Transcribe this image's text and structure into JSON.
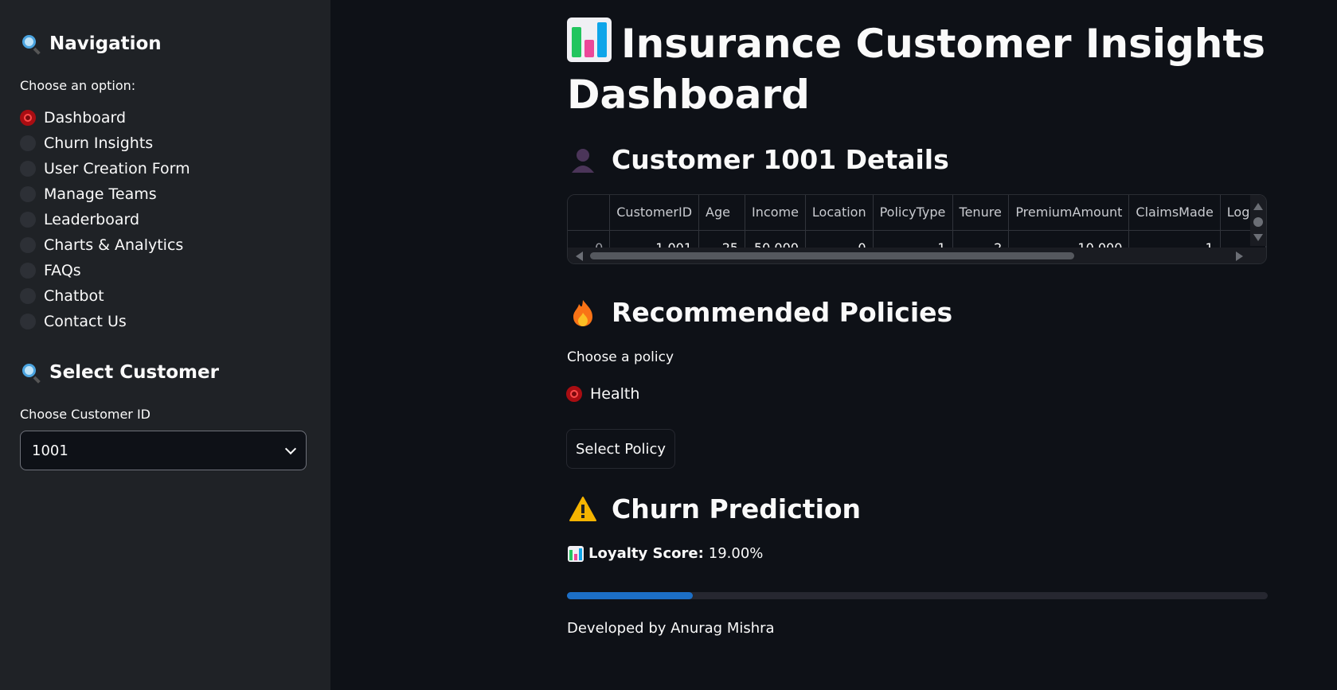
{
  "sidebar": {
    "nav_heading": "Navigation",
    "nav_prompt": "Choose an option:",
    "nav_items": [
      {
        "label": "Dashboard",
        "selected": true
      },
      {
        "label": "Churn Insights",
        "selected": false
      },
      {
        "label": "User Creation Form",
        "selected": false
      },
      {
        "label": "Manage Teams",
        "selected": false
      },
      {
        "label": "Leaderboard",
        "selected": false
      },
      {
        "label": "Charts & Analytics",
        "selected": false
      },
      {
        "label": "FAQs",
        "selected": false
      },
      {
        "label": "Chatbot",
        "selected": false
      },
      {
        "label": "Contact Us",
        "selected": false
      }
    ],
    "customer_heading": "Select Customer",
    "customer_prompt": "Choose Customer ID",
    "customer_value": "1001"
  },
  "main": {
    "title": "Insurance Customer Insights Dashboard",
    "details_heading": "Customer 1001 Details",
    "table": {
      "columns": [
        "",
        "CustomerID",
        "Age",
        "Income",
        "Location",
        "PolicyType",
        "Tenure",
        "PremiumAmount",
        "ClaimsMade",
        "Logi"
      ],
      "rows": [
        [
          "0",
          "1,001",
          "25",
          "50,000",
          "0",
          "1",
          "2",
          "10,000",
          "1",
          ""
        ]
      ]
    },
    "recommend_heading": "Recommended Policies",
    "policy_prompt": "Choose a policy",
    "policy_option": "Health",
    "select_button": "Select Policy",
    "churn_heading": "Churn Prediction",
    "loyalty_label": "Loyalty Score:",
    "loyalty_value": "19.00%",
    "loyalty_progress": 0.18,
    "footer": "Developed by Anurag Mishra"
  },
  "colors": {
    "background": "#0e1117",
    "sidebar": "#1f2226",
    "radio_selected": "#a90d12",
    "progress": "#1c6fc6"
  }
}
